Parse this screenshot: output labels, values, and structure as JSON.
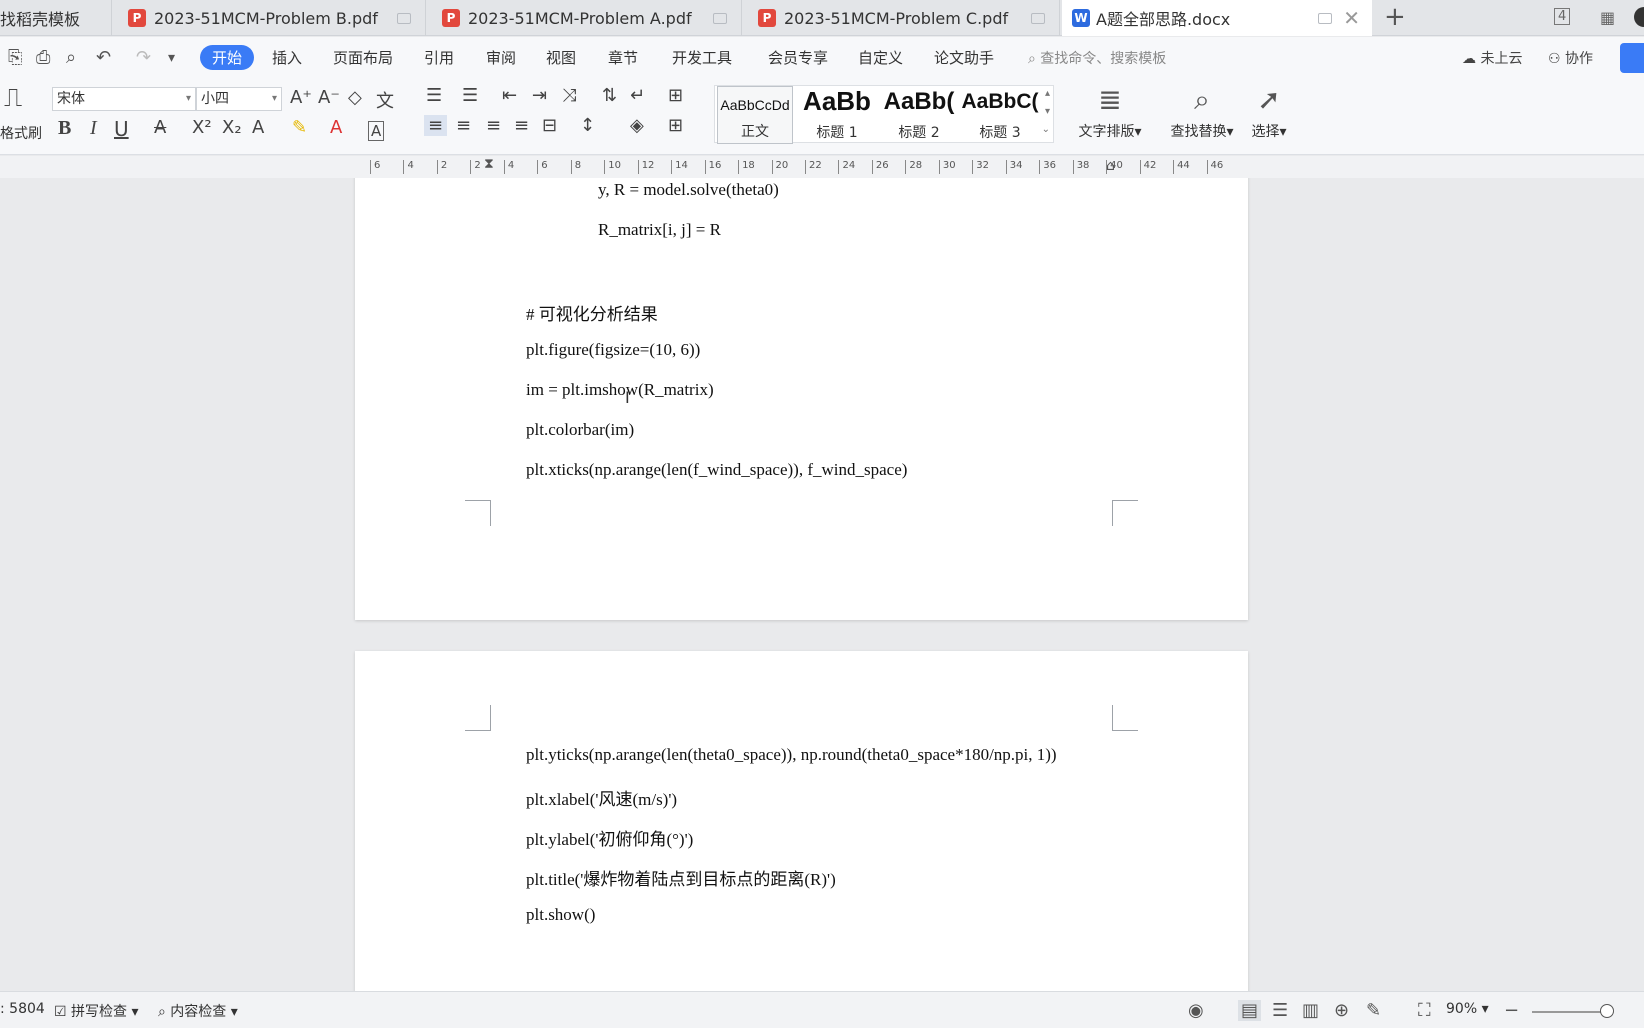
{
  "tabs": [
    {
      "label": "找稻壳模板",
      "type": "home"
    },
    {
      "label": "2023-51MCM-Problem B.pdf",
      "type": "pdf"
    },
    {
      "label": "2023-51MCM-Problem A.pdf",
      "type": "pdf"
    },
    {
      "label": "2023-51MCM-Problem C.pdf",
      "type": "pdf"
    },
    {
      "label": "A题全部思路.docx",
      "type": "doc",
      "active": true
    }
  ],
  "tabbar_right": {
    "page_count": "4"
  },
  "menu": {
    "items": [
      "开始",
      "插入",
      "页面布局",
      "引用",
      "审阅",
      "视图",
      "章节",
      "开发工具",
      "会员专享",
      "自定义",
      "论文助手"
    ],
    "active": "开始",
    "search_placeholder": "查找命令、搜索模板",
    "cloud_status": "未上云",
    "collab": "协作"
  },
  "ribbon": {
    "format_painter": "格式刷",
    "font_name": "宋体",
    "font_size": "小四",
    "styles": [
      {
        "preview": "AaBbCcDd",
        "caption": "正文"
      },
      {
        "preview": "AaBb",
        "caption": "标题 1"
      },
      {
        "preview": "AaBb(",
        "caption": "标题 2"
      },
      {
        "preview": "AaBbC(",
        "caption": "标题 3"
      }
    ],
    "text_layout": "文字排版",
    "find_replace": "查找替换",
    "select": "选择"
  },
  "ruler_ticks": [
    "6",
    "4",
    "2",
    "2",
    "4",
    "6",
    "8",
    "10",
    "12",
    "14",
    "16",
    "18",
    "20",
    "22",
    "24",
    "26",
    "28",
    "30",
    "32",
    "34",
    "36",
    "38",
    "40",
    "42",
    "44",
    "46"
  ],
  "document": {
    "page1_lines": [
      "y, R = model.solve(theta0)",
      "R_matrix[i, j] = R",
      "#  可视化分析结果",
      "plt.figure(figsize=(10, 6))",
      "im = plt.imshow(R_matrix)",
      "plt.colorbar(im)",
      "plt.xticks(np.arange(len(f_wind_space)), f_wind_space)"
    ],
    "page2_lines": [
      "plt.yticks(np.arange(len(theta0_space)), np.round(theta0_space*180/np.pi, 1))",
      "plt.xlabel('风速(m/s)')",
      "plt.ylabel('初俯仰角(°)')",
      "plt.title('爆炸物着陆点到目标点的距离(R)')",
      "plt.show()"
    ]
  },
  "statusbar": {
    "word_count": ": 5804",
    "spell_check": "拼写检查",
    "content_check": "内容检查",
    "zoom": "90%"
  }
}
